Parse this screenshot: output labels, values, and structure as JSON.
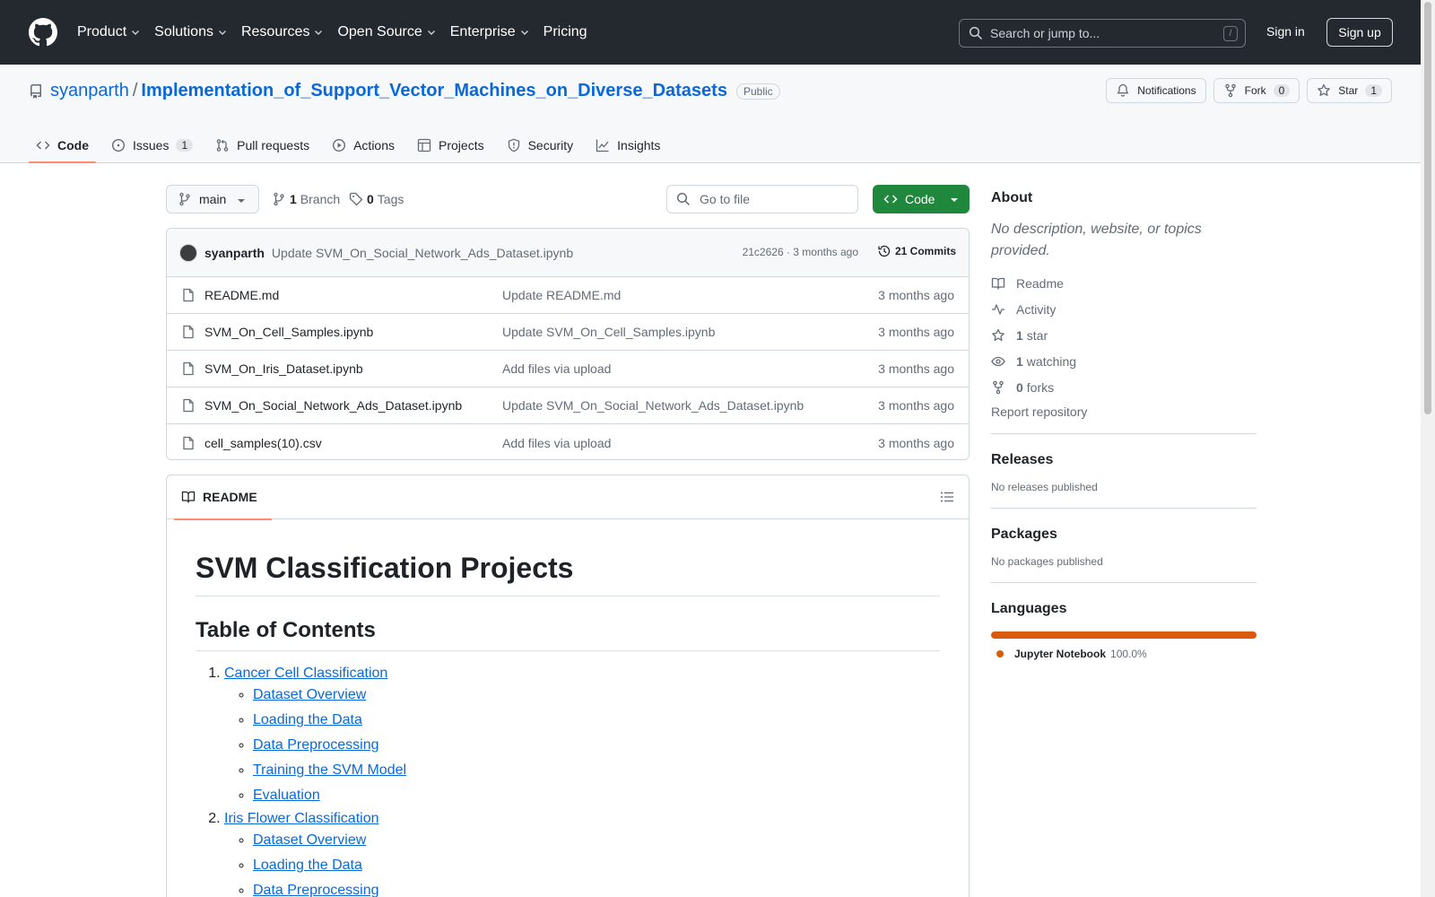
{
  "header": {
    "nav": [
      {
        "label": "Product",
        "caret": true
      },
      {
        "label": "Solutions",
        "caret": true
      },
      {
        "label": "Resources",
        "caret": true
      },
      {
        "label": "Open Source",
        "caret": true
      },
      {
        "label": "Enterprise",
        "caret": true
      },
      {
        "label": "Pricing",
        "caret": false
      }
    ],
    "search_placeholder": "Search or jump to...",
    "search_shortcut": "/",
    "signin": "Sign in",
    "signup": "Sign up"
  },
  "repo": {
    "owner": "syanparth",
    "separator": "/",
    "name": "Implementation_of_Support_Vector_Machines_on_Diverse_Datasets",
    "visibility": "Public",
    "notifications": "Notifications",
    "fork_label": "Fork",
    "fork_count": "0",
    "star_label": "Star",
    "star_count": "1",
    "tabs": [
      {
        "label": "Code",
        "count": ""
      },
      {
        "label": "Issues",
        "count": "1"
      },
      {
        "label": "Pull requests",
        "count": ""
      },
      {
        "label": "Actions",
        "count": ""
      },
      {
        "label": "Projects",
        "count": ""
      },
      {
        "label": "Security",
        "count": ""
      },
      {
        "label": "Insights",
        "count": ""
      }
    ]
  },
  "toolbar": {
    "branch": "main",
    "branch_count": "1",
    "branch_label": "Branch",
    "tag_count": "0",
    "tag_label": "Tags",
    "goto_placeholder": "Go to file",
    "code_label": "Code"
  },
  "commit": {
    "author": "syanparth",
    "message": "Update SVM_On_Social_Network_Ads_Dataset.ipynb",
    "sha_time": "21c2626 · 3 months ago",
    "commits": "21 Commits"
  },
  "files": [
    {
      "name": "README.md",
      "message": "Update README.md",
      "age": "3 months ago"
    },
    {
      "name": "SVM_On_Cell_Samples.ipynb",
      "message": "Update SVM_On_Cell_Samples.ipynb",
      "age": "3 months ago"
    },
    {
      "name": "SVM_On_Iris_Dataset.ipynb",
      "message": "Add files via upload",
      "age": "3 months ago"
    },
    {
      "name": "SVM_On_Social_Network_Ads_Dataset.ipynb",
      "message": "Update SVM_On_Social_Network_Ads_Dataset.ipynb",
      "age": "3 months ago"
    },
    {
      "name": "cell_samples(10).csv",
      "message": "Add files via upload",
      "age": "3 months ago"
    }
  ],
  "readme": {
    "tab": "README",
    "h1": "SVM Classification Projects",
    "h2": "Table of Contents",
    "toc": [
      {
        "label": "Cancer Cell Classification",
        "items": [
          "Dataset Overview",
          "Loading the Data",
          "Data Preprocessing",
          "Training the SVM Model",
          "Evaluation"
        ]
      },
      {
        "label": "Iris Flower Classification",
        "items": [
          "Dataset Overview",
          "Loading the Data",
          "Data Preprocessing"
        ]
      }
    ]
  },
  "sidebar": {
    "about_title": "About",
    "about_desc": "No description, website, or topics provided.",
    "readme": "Readme",
    "activity": "Activity",
    "stars_count": "1",
    "stars_label": "star",
    "watching_count": "1",
    "watching_label": "watching",
    "forks_count": "0",
    "forks_label": "forks",
    "report": "Report repository",
    "releases_title": "Releases",
    "releases_empty": "No releases published",
    "packages_title": "Packages",
    "packages_empty": "No packages published",
    "languages_title": "Languages",
    "language_name": "Jupyter Notebook",
    "language_pct": "100.0%",
    "language_color": "#da5b0b"
  },
  "colors": {
    "header_bg": "#24292f",
    "link": "#0969da",
    "primary_button": "#1f883d",
    "selected_tab_underline": "#fd8c73"
  }
}
